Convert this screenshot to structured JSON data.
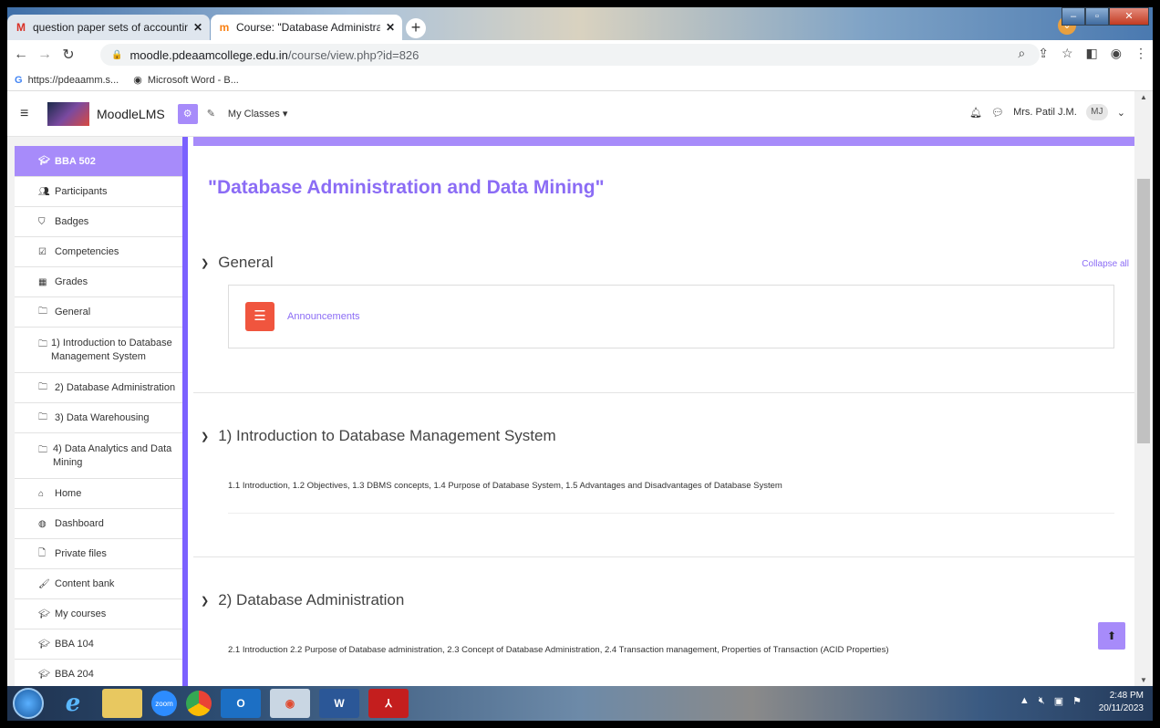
{
  "browser": {
    "tabs": [
      {
        "label": "question paper sets of accountin",
        "icon": "gmail-icon"
      },
      {
        "label": "Course: \"Database Administration",
        "icon": "moodle-icon"
      }
    ],
    "url_host": "moodle.pdeaamcollege.edu.in",
    "url_path": "/course/view.php?id=826",
    "bookmarks": [
      {
        "label": "https://pdeaamm.s...",
        "icon": "google-icon"
      },
      {
        "label": "Microsoft Word - B...",
        "icon": "globe-icon"
      }
    ]
  },
  "moodle": {
    "brand": "MoodleLMS",
    "my_classes": "My Classes",
    "user_name": "Mrs. Patil J.M.",
    "user_initials": "MJ"
  },
  "drawer": {
    "course": "BBA 502",
    "items": [
      {
        "label": "Participants",
        "icon": "users-icon"
      },
      {
        "label": "Badges",
        "icon": "badge-icon"
      },
      {
        "label": "Competencies",
        "icon": "checkbox-icon"
      },
      {
        "label": "Grades",
        "icon": "table-icon"
      },
      {
        "label": "General",
        "icon": "folder-icon"
      },
      {
        "label": "1) Introduction to Database Management System",
        "icon": "folder-icon"
      },
      {
        "label": "2) Database Administration",
        "icon": "folder-icon"
      },
      {
        "label": "3) Data Warehousing",
        "icon": "folder-icon"
      },
      {
        "label": "4) Data Analytics and Data Mining",
        "icon": "folder-icon"
      }
    ],
    "site_items": [
      {
        "label": "Home",
        "icon": "home-icon"
      },
      {
        "label": "Dashboard",
        "icon": "dashboard-icon"
      },
      {
        "label": "Private files",
        "icon": "file-icon"
      },
      {
        "label": "Content bank",
        "icon": "brush-icon"
      },
      {
        "label": "My courses",
        "icon": "graduation-cap-icon"
      },
      {
        "label": "BBA 104",
        "icon": "graduation-cap-icon"
      },
      {
        "label": "BBA 204",
        "icon": "graduation-cap-icon"
      }
    ]
  },
  "course": {
    "title": "\"Database Administration and Data Mining\"",
    "collapse_all": "Collapse all",
    "sections": [
      {
        "name": "General",
        "activity": "Announcements"
      },
      {
        "name": "1) Introduction to Database Management System",
        "summary": "1.1 Introduction, 1.2 Objectives, 1.3 DBMS concepts, 1.4 Purpose of Database System, 1.5 Advantages and Disadvantages of Database System"
      },
      {
        "name": "2) Database Administration",
        "summary": "2.1 Introduction 2.2 Purpose of Database administration, 2.3 Concept of Database Administration, 2.4 Transaction management, Properties of Transaction (ACID Properties)"
      }
    ]
  },
  "taskbar": {
    "time": "2:48 PM",
    "date": "20/11/2023",
    "apps": [
      "ie-icon",
      "explorer-icon",
      "zoom-icon",
      "chrome-icon",
      "outlook-icon",
      "chrome-profile-icon",
      "word-icon",
      "acrobat-icon"
    ],
    "zoom_label": "zoom"
  },
  "colors": {
    "accent": "#a78bfa",
    "accent_text": "#8b6cf5",
    "announce": "#f0553e"
  }
}
